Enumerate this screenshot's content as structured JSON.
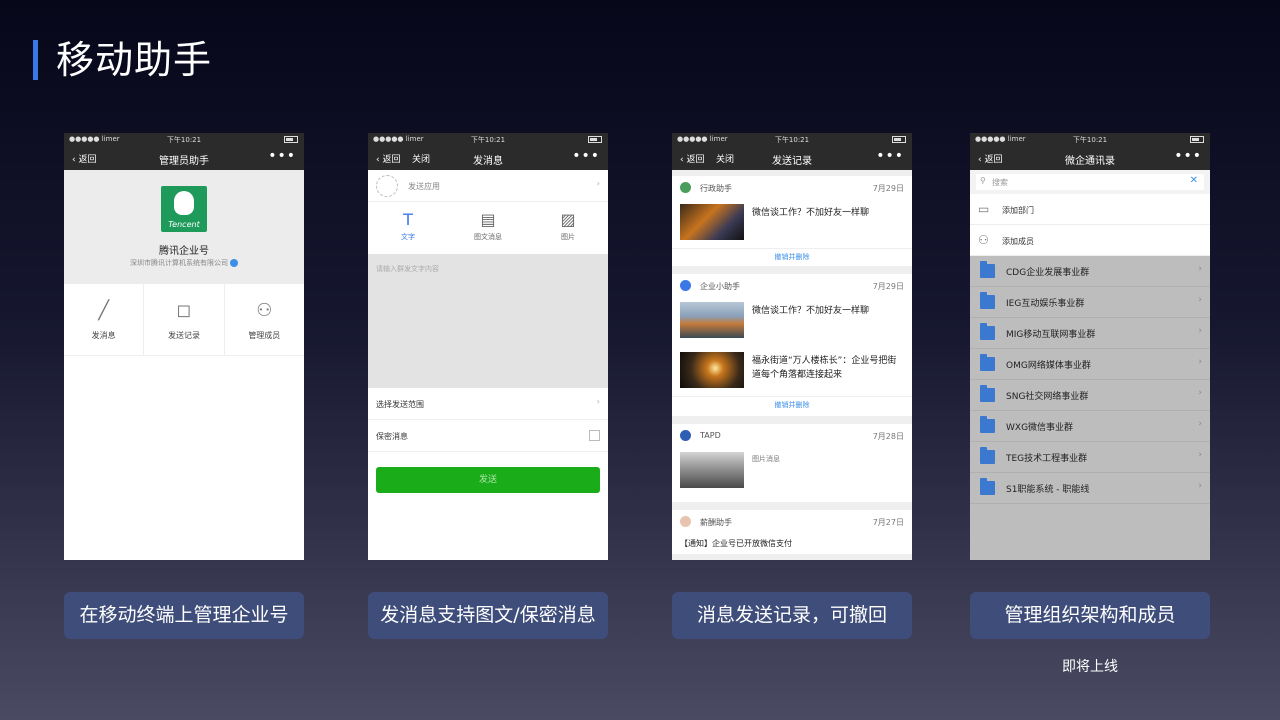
{
  "slide": {
    "title": "移动助手",
    "accent_color": "#3b78e7"
  },
  "status_bar": {
    "carrier": "●●●●● limer",
    "time": "下午10:21"
  },
  "phones": {
    "admin": {
      "nav": {
        "back": "返回",
        "title": "管理员助手",
        "more": "•••"
      },
      "logo_text": "Tencent",
      "company_name": "腾讯企业号",
      "company_sub": "深圳市腾讯计算机系统有限公司",
      "actions": [
        {
          "label": "发消息",
          "icon": "pen-icon"
        },
        {
          "label": "发送记录",
          "icon": "clock-icon"
        },
        {
          "label": "管理成员",
          "icon": "members-icon"
        }
      ]
    },
    "send": {
      "nav": {
        "back": "返回",
        "close": "关闭",
        "title": "发消息",
        "more": "•••"
      },
      "app_row": "发送应用",
      "types": [
        {
          "label": "文字",
          "icon": "text-icon"
        },
        {
          "label": "图文消息",
          "icon": "article-icon"
        },
        {
          "label": "图片",
          "icon": "image-icon"
        }
      ],
      "placeholder": "请输入群发文字内容",
      "scope_label": "选择发送范围",
      "secret_label": "保密消息",
      "send_label": "发送",
      "send_color": "#1aad19"
    },
    "records": {
      "nav": {
        "back": "返回",
        "close": "关闭",
        "title": "发送记录",
        "more": "•••"
      },
      "revoke_label": "撤销并删除",
      "cards": [
        {
          "source": "行政助手",
          "date": "7月29日",
          "messages": [
            "微信谈工作？不加好友一样聊"
          ]
        },
        {
          "source": "企业小助手",
          "date": "7月29日",
          "messages": [
            "微信谈工作？不加好友一样聊",
            "福永街道“万人楼栋长”：企业号把街道每个角落都连接起来"
          ]
        },
        {
          "source": "TAPD",
          "date": "7月28日",
          "messages": [
            "图片消息"
          ]
        },
        {
          "source": "薪酬助手",
          "date": "7月27日",
          "messages": [
            "【通知】企业号已开放微信支付"
          ]
        }
      ]
    },
    "contacts": {
      "nav": {
        "back": "返回",
        "title": "微企通讯录",
        "more": "•••"
      },
      "search_placeholder": "搜索",
      "add_dept": "添加部门",
      "add_member": "添加成员",
      "departments": [
        "CDG企业发展事业群",
        "IEG互动娱乐事业群",
        "MIG移动互联网事业群",
        "OMG网络媒体事业群",
        "SNG社交网络事业群",
        "WXG微信事业群",
        "TEG技术工程事业群",
        "S1职能系统 - 职能线"
      ]
    }
  },
  "captions": [
    "在移动终端上管理企业号",
    "发消息支持图文/保密消息",
    "消息发送记录，可撤回",
    "管理组织架构和成员"
  ],
  "coming_soon": "即将上线"
}
